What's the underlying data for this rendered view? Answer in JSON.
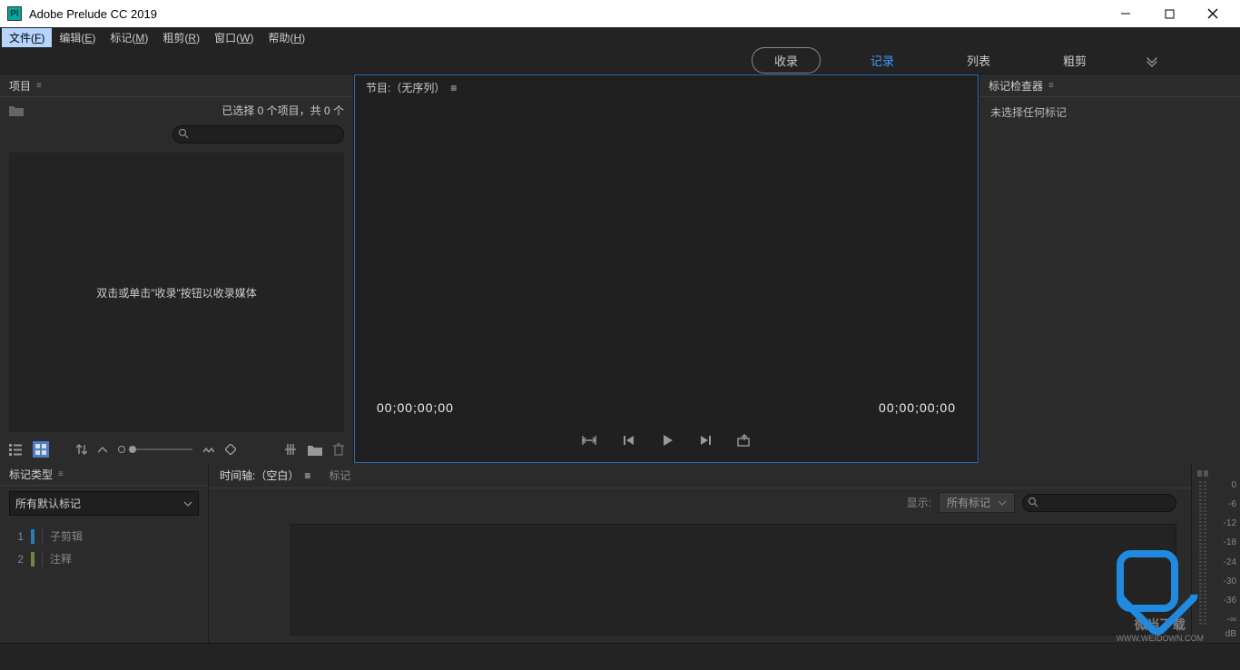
{
  "app": {
    "title": "Adobe Prelude CC 2019",
    "icon_text": "Pl"
  },
  "menu": {
    "file": "文件",
    "file_key": "F",
    "edit": "编辑",
    "edit_key": "E",
    "marker": "标记",
    "marker_key": "M",
    "roughcut": "粗剪",
    "roughcut_key": "R",
    "window": "窗口",
    "window_key": "W",
    "help": "帮助",
    "help_key": "H"
  },
  "workspace": {
    "ingest": "收录",
    "logging": "记录",
    "list": "列表",
    "roughcut": "粗剪"
  },
  "project": {
    "title": "项目",
    "selection": "已选择 0 个项目，共 0 个",
    "hint": "双击或单击\"收录\"按钮以收录媒体",
    "search_placeholder": ""
  },
  "program": {
    "title": "节目:（无序列）",
    "tc_left": "00;00;00;00",
    "tc_right": "00;00;00;00"
  },
  "inspector": {
    "title": "标记检查器",
    "empty": "未选择任何标记"
  },
  "markerTypes": {
    "title": "标记类型",
    "selector": "所有默认标记",
    "items": [
      {
        "num": "1",
        "label": "子剪辑",
        "color": "#2b7bb9"
      },
      {
        "num": "2",
        "label": "注释",
        "color": "#6a8a3f"
      }
    ]
  },
  "timeline": {
    "tab1": "时间轴:（空白）",
    "tab2": "标记",
    "show_label": "显示:",
    "filter": "所有标记",
    "search_placeholder": ""
  },
  "audioMeter": {
    "scale": [
      "0",
      "-6",
      "-12",
      "-18",
      "-24",
      "-30",
      "-36",
      "-∞"
    ],
    "unit": "dB"
  },
  "watermark": {
    "cn": "微当下载",
    "url": "WWW.WEIDOWN.COM"
  }
}
